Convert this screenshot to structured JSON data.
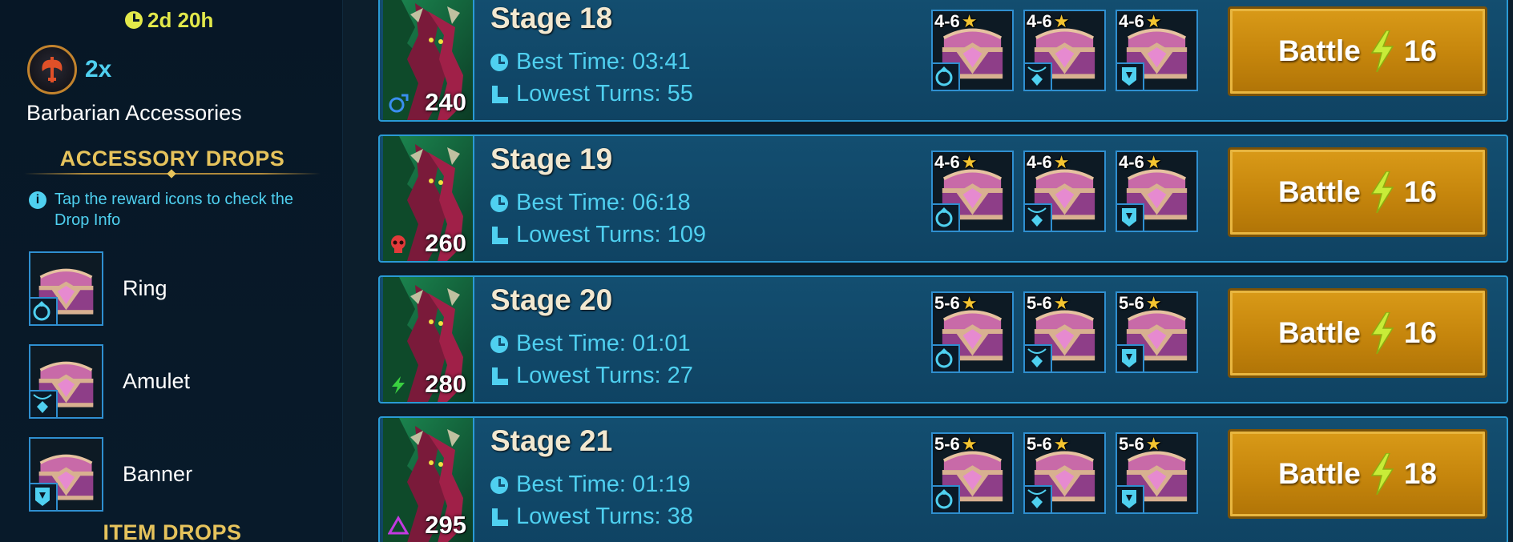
{
  "left_panel": {
    "timer": "2d 20h",
    "bonus_multiplier": "2x",
    "set_name": "Barbarian Accessories",
    "accessory_drops_title": "ACCESSORY DROPS",
    "info_text": "Tap the reward icons to check the Drop Info",
    "drops": [
      {
        "label": "Ring",
        "icon": "ring-icon"
      },
      {
        "label": "Amulet",
        "icon": "amulet-icon"
      },
      {
        "label": "Banner",
        "icon": "banner-icon"
      }
    ],
    "item_drops_title": "ITEM DROPS"
  },
  "stages": [
    {
      "title": "Stage 18",
      "best_time_label": "Best Time: 03:41",
      "lowest_turns_label": "Lowest Turns: 55",
      "power": "240",
      "affinity": "magic",
      "reward_rank": "4-6",
      "battle_label": "Battle",
      "energy_cost": "16"
    },
    {
      "title": "Stage 19",
      "best_time_label": "Best Time: 06:18",
      "lowest_turns_label": "Lowest Turns: 109",
      "power": "260",
      "affinity": "force",
      "reward_rank": "4-6",
      "battle_label": "Battle",
      "energy_cost": "16"
    },
    {
      "title": "Stage 20",
      "best_time_label": "Best Time: 01:01",
      "lowest_turns_label": "Lowest Turns: 27",
      "power": "280",
      "affinity": "spirit",
      "reward_rank": "5-6",
      "battle_label": "Battle",
      "energy_cost": "16"
    },
    {
      "title": "Stage 21",
      "best_time_label": "Best Time: 01:19",
      "lowest_turns_label": "Lowest Turns: 38",
      "power": "295",
      "affinity": "void",
      "reward_rank": "5-6",
      "battle_label": "Battle",
      "energy_cost": "18"
    }
  ],
  "reward_types": [
    "ring-icon",
    "amulet-icon",
    "banner-icon"
  ],
  "colors": {
    "accent_cyan": "#4fd0f0",
    "gold_title": "#e6c35c",
    "timer_yellow": "#e2e84a",
    "battle_button": "#c5850c",
    "stage_bg": "#134e70",
    "star": "#f4c430"
  }
}
